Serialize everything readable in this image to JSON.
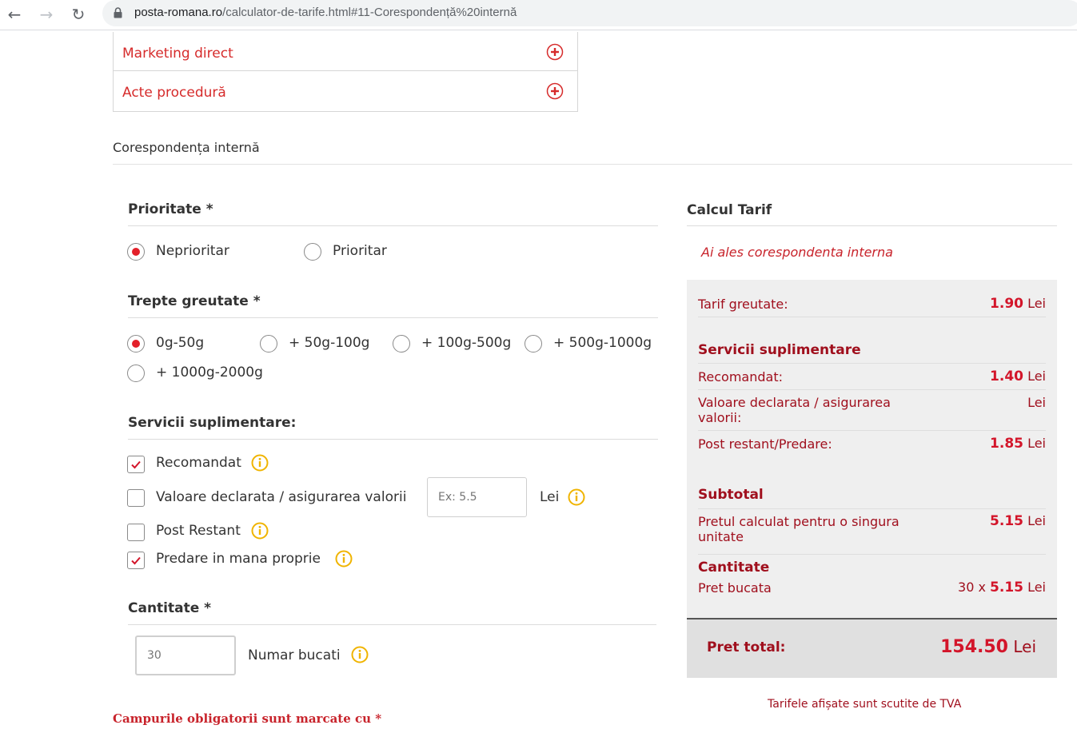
{
  "browser": {
    "url_host": "posta-romana.ro",
    "url_path": "/calculator-de-tarife.html#11-Corespondență%20internă"
  },
  "accordion": {
    "items": [
      {
        "label": "Marketing direct"
      },
      {
        "label": "Acte procedură"
      }
    ]
  },
  "section": {
    "title": "Corespondența internă"
  },
  "prioritate": {
    "label": "Prioritate *",
    "options": [
      {
        "label": "Neprioritar",
        "checked": true
      },
      {
        "label": "Prioritar",
        "checked": false
      }
    ]
  },
  "greutate": {
    "label": "Trepte greutate *",
    "options": [
      {
        "label": "0g-50g",
        "checked": true
      },
      {
        "label": "+ 50g-100g",
        "checked": false
      },
      {
        "label": "+ 100g-500g",
        "checked": false
      },
      {
        "label": "+ 500g-1000g",
        "checked": false
      },
      {
        "label": "+ 1000g-2000g",
        "checked": false
      }
    ]
  },
  "servicii": {
    "label": "Servicii suplimentare:",
    "items": [
      {
        "label": "Recomandat",
        "checked": true
      },
      {
        "label": "Valoare declarata / asigurarea valorii",
        "checked": false
      },
      {
        "label": "Post Restant",
        "checked": false
      },
      {
        "label": "Predare in mana proprie",
        "checked": true
      }
    ],
    "valoare_placeholder": "Ex: 5.5",
    "valoare_unit": "Lei"
  },
  "cantitate": {
    "label": "Cantitate *",
    "value": "30",
    "unit_label": "Numar bucati"
  },
  "required_note": "Campurile obligatorii sunt marcate cu *",
  "calc": {
    "title": "Calcul Tarif",
    "choice": "Ai ales corespondenta interna",
    "tarif_greutate": {
      "label": "Tarif greutate:",
      "value": "1.90",
      "unit": "Lei"
    },
    "servicii_title": "Servicii suplimentare",
    "recomandat": {
      "label": "Recomandat:",
      "value": "1.40",
      "unit": "Lei"
    },
    "valoare": {
      "label": "Valoare declarata / asigurarea valorii:",
      "value": "",
      "unit": "Lei"
    },
    "post_restant": {
      "label": "Post restant/Predare:",
      "value": "1.85",
      "unit": "Lei"
    },
    "subtotal_title": "Subtotal",
    "pret_unitate": {
      "label": "Pretul calculat pentru o singura unitate",
      "value": "5.15",
      "unit": "Lei"
    },
    "cantitate_title": "Cantitate",
    "pret_bucata": {
      "label": "Pret bucata",
      "qty": "30",
      "x": "x",
      "value": "5.15",
      "unit": "Lei"
    },
    "total": {
      "label": "Pret total:",
      "value": "154.50",
      "unit": "Lei"
    },
    "tva_note": "Tarifele afișate sunt scutite de TVA"
  },
  "colors": {
    "accent_red": "#d3152a",
    "dark_red": "#a00f1d",
    "info_yellow": "#f0b400"
  }
}
